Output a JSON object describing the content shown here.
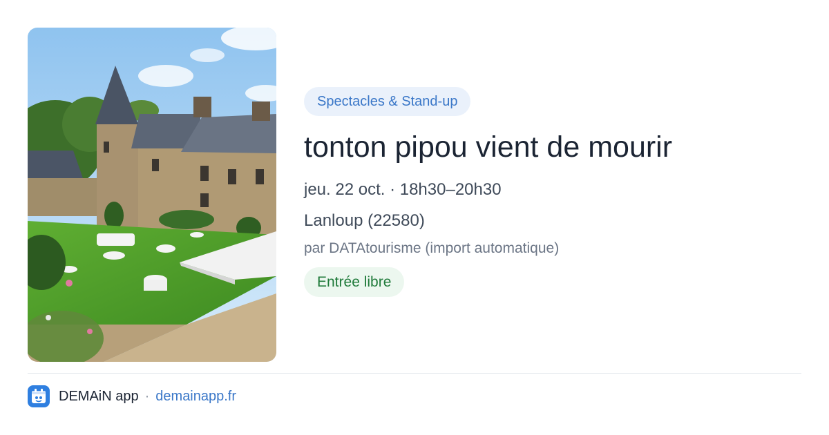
{
  "event": {
    "category": "Spectacles & Stand-up",
    "title": "tonton pipou vient de mourir",
    "datetime": "jeu. 22 oct. · 18h30–20h30",
    "location": "Lanloup (22580)",
    "source": "par DATAtourisme (import automatique)",
    "price": "Entrée libre",
    "image_icon": "chateau-garden-photo"
  },
  "footer": {
    "app_name": "DEMAiN app",
    "separator": "·",
    "url": "demainapp.fr",
    "app_icon": "demain-app-logo-icon"
  },
  "colors": {
    "category_bg": "#eaf1fb",
    "category_text": "#3a77c8",
    "price_bg": "#ecf7ef",
    "price_text": "#1f7a3a",
    "accent": "#2f7fe0"
  }
}
